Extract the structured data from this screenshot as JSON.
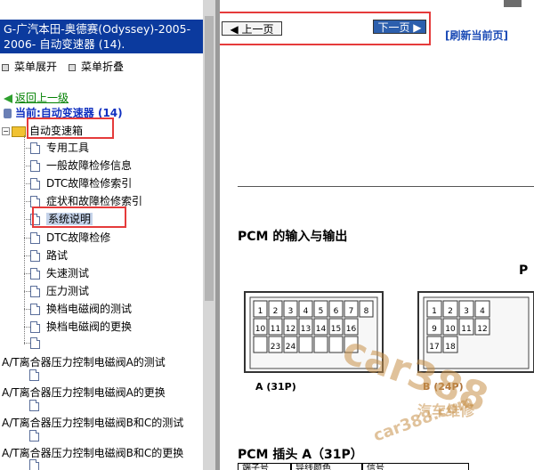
{
  "left_pane": {
    "title": "G-广汽本田-奥德赛(Odyssey)-2005-2006- 自动变速器 (14).",
    "menu_expand": "菜单展开",
    "menu_collapse": "菜单折叠",
    "back_link": "返回上一级",
    "current": "当前:自动变速器 (14)",
    "root_node": "自动变速箱",
    "tree_items": [
      {
        "label": "专用工具"
      },
      {
        "label": "一般故障检修信息"
      },
      {
        "label": "DTC故障检修索引"
      },
      {
        "label": "症状和故障检修索引"
      },
      {
        "label": "系统说明",
        "selected": true
      },
      {
        "label": "DTC故障检修"
      },
      {
        "label": "路试"
      },
      {
        "label": "失速测试"
      },
      {
        "label": "压力测试"
      },
      {
        "label": "换档电磁阀的测试"
      },
      {
        "label": "换档电磁阀的更换"
      },
      {
        "label": ""
      }
    ],
    "long_items": [
      "A/T离合器压力控制电磁阀A的测试",
      "A/T离合器压力控制电磁阀A的更换",
      "A/T离合器压力控制电磁阀B和C的测试",
      "A/T离合器压力控制电磁阀B和C的更换"
    ]
  },
  "right_pane": {
    "prev_page": "上一页",
    "next_page": "下一页",
    "refresh": "[刷新当前页]",
    "section_heading": "PCM 的输入与输出",
    "right_fragment": "P",
    "connector_a_label": "A (31P)",
    "connector_b_label": "B (24P)",
    "connector_a_pins": [
      [
        "1",
        "2",
        "3",
        "4",
        "5",
        "6",
        "7",
        "8"
      ],
      [
        "10",
        "11",
        "12",
        "13",
        "14",
        "15",
        "16"
      ],
      [
        "",
        "23",
        "24",
        "",
        "",
        "",
        ""
      ]
    ],
    "connector_b_pins": [
      [
        "1",
        "2",
        "3",
        "4"
      ],
      [
        "9",
        "10",
        "11",
        "12"
      ],
      [
        "17",
        "18"
      ]
    ],
    "connector_heading": "PCM 插头 A（31P）",
    "table_headers": [
      "端子号",
      "导线颜色",
      "信号"
    ],
    "watermark_main": "car388",
    "watermark_sub": "car388.com",
    "watermark_cn": "汽车维修"
  }
}
